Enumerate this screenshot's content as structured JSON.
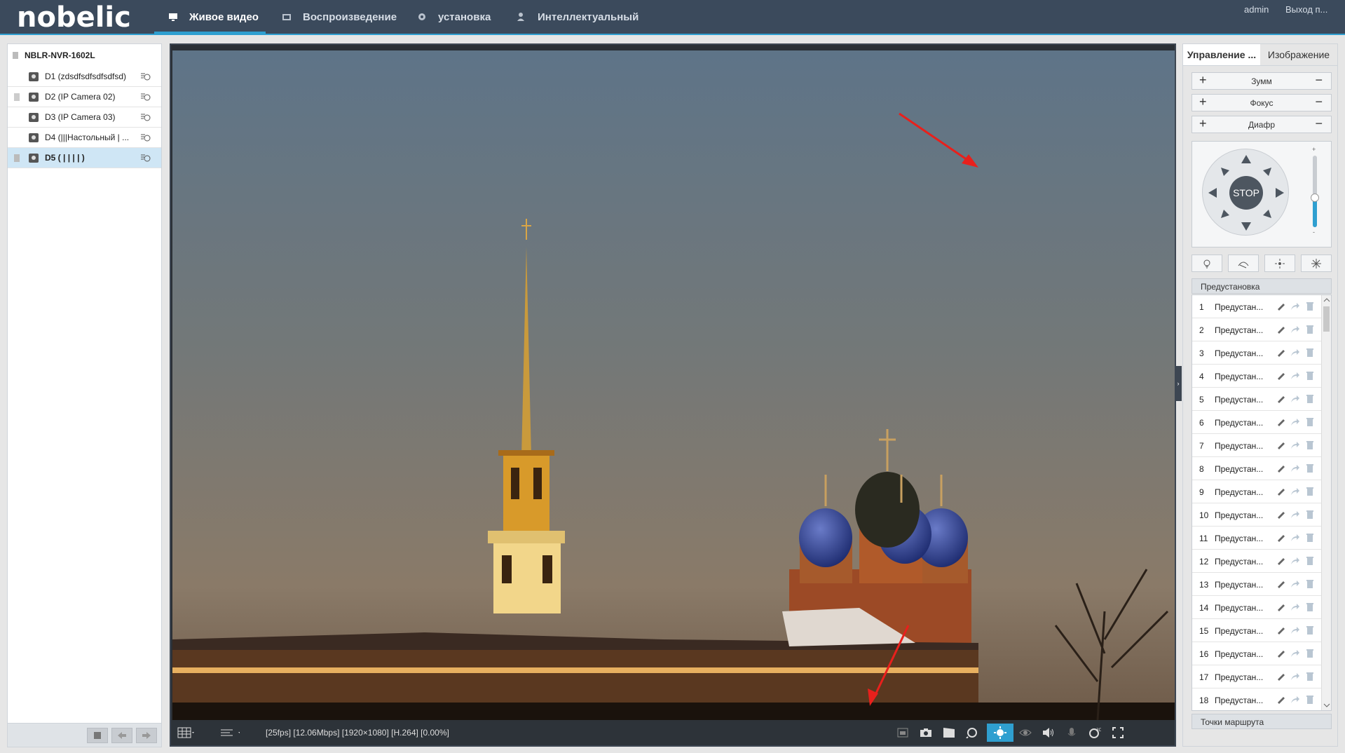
{
  "app": {
    "logo": "nobelic",
    "user": "admin",
    "logout": "Выход п..."
  },
  "nav": [
    {
      "label": "Живое видео",
      "icon": "monitor-icon",
      "active": true
    },
    {
      "label": "Воспроизведение",
      "icon": "playback-icon"
    },
    {
      "label": "установка",
      "icon": "gear-icon"
    },
    {
      "label": "Интеллектуальный",
      "icon": "person-icon"
    }
  ],
  "tree": {
    "root": "NBLR-NVR-1602L",
    "devices": [
      {
        "label": "D1 (zdsdfsdfsdfsdfsd)"
      },
      {
        "label": "D2 (IP Camera 02)"
      },
      {
        "label": "D3 (IP Camera 03)"
      },
      {
        "label": "D4 (|||Настольный | ..."
      },
      {
        "label": "D5 ( | | | | )",
        "selected": true
      }
    ]
  },
  "video": {
    "stream_info": "[25fps] [12.06Mbps] [1920×1080] [H.264] [0.00%]"
  },
  "ptz": {
    "tabs": [
      "Управление ...",
      "Изображение"
    ],
    "zoom": "Зумм",
    "focus": "Фокус",
    "iris": "Диафр",
    "stop": "STOP",
    "speed_plus": "+",
    "speed_minus": "-",
    "preset_header": "Предустановка",
    "presets": [
      {
        "n": "1",
        "t": "Предустан..."
      },
      {
        "n": "2",
        "t": "Предустан..."
      },
      {
        "n": "3",
        "t": "Предустан..."
      },
      {
        "n": "4",
        "t": "Предустан..."
      },
      {
        "n": "5",
        "t": "Предустан..."
      },
      {
        "n": "6",
        "t": "Предустан..."
      },
      {
        "n": "7",
        "t": "Предустан..."
      },
      {
        "n": "8",
        "t": "Предустан..."
      },
      {
        "n": "9",
        "t": "Предустан..."
      },
      {
        "n": "10",
        "t": "Предустан..."
      },
      {
        "n": "11",
        "t": "Предустан..."
      },
      {
        "n": "12",
        "t": "Предустан..."
      },
      {
        "n": "13",
        "t": "Предустан..."
      },
      {
        "n": "14",
        "t": "Предустан..."
      },
      {
        "n": "15",
        "t": "Предустан..."
      },
      {
        "n": "16",
        "t": "Предустан..."
      },
      {
        "n": "17",
        "t": "Предустан..."
      },
      {
        "n": "18",
        "t": "Предустан..."
      }
    ],
    "tour_header": "Точки маршрута"
  },
  "colors": {
    "accent": "#2f9fd0",
    "topbar": "#3b4a5c",
    "annotation_arrow": "#e8201c"
  }
}
